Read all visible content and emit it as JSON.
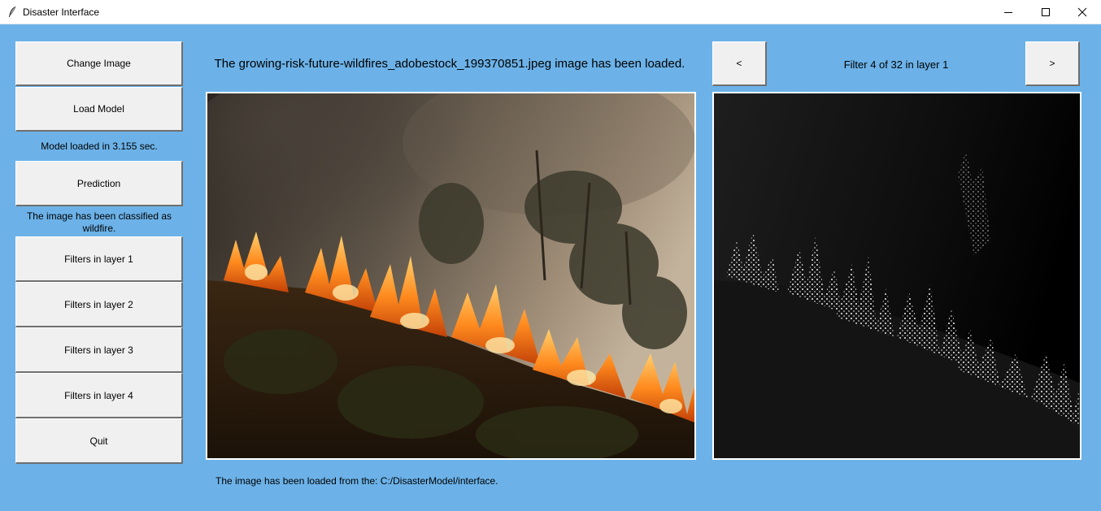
{
  "window": {
    "title": "Disaster Interface",
    "controls": [
      "minimize",
      "maximize",
      "close"
    ]
  },
  "sidebar": {
    "change_image": "Change Image",
    "load_model": "Load Model",
    "model_status": "Model loaded in 3.155 sec.",
    "prediction": "Prediction",
    "prediction_result_line1": "The image has been classified as",
    "prediction_result_line2": "wildfire.",
    "filters_layer_1": "Filters in layer 1",
    "filters_layer_2": "Filters in layer 2",
    "filters_layer_3": "Filters in layer 3",
    "filters_layer_4": "Filters in layer 4",
    "quit": "Quit"
  },
  "main": {
    "image_status": "The growing-risk-future-wildfires_adobestock_199370851.jpeg image has been loaded.",
    "path_status": "The image has been loaded from the: C:/DisasterModel/interface."
  },
  "filter_panel": {
    "prev_label": "<",
    "next_label": ">",
    "filter_status": "Filter 4 of 32 in layer 1"
  },
  "colors": {
    "background": "#6cb2e8",
    "button": "#f0f0f0"
  },
  "icons": {
    "app": "feather-icon",
    "minimize": "minimize-icon",
    "maximize": "maximize-icon",
    "close": "close-icon"
  }
}
